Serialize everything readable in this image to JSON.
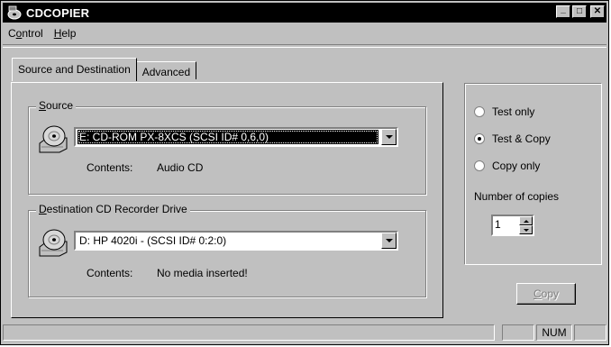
{
  "app": {
    "title": "CDCOPIER"
  },
  "window_controls": {
    "minimize": "_",
    "maximize": "□",
    "close": "✕"
  },
  "menu": [
    {
      "prefix": "C",
      "underlined": "o",
      "rest": "ntrol"
    },
    {
      "prefix": "",
      "underlined": "H",
      "rest": "elp"
    }
  ],
  "tabs": {
    "source_destination": "Source and Destination",
    "advanced": "Advanced"
  },
  "source": {
    "legend_underlined": "S",
    "legend_rest": "ource",
    "drive": "E: CD-ROM PX-8XCS   (SCSI ID# 0,6,0)",
    "contents_label": "Contents:",
    "contents_value": "Audio CD"
  },
  "destination": {
    "legend_underlined": "D",
    "legend_rest": "estination CD Recorder Drive",
    "drive": "D: HP 4020i - (SCSI ID# 0:2:0)",
    "contents_label": "Contents:",
    "contents_value": "No media inserted!"
  },
  "mode": {
    "options": [
      {
        "label": "Test only",
        "checked": false
      },
      {
        "label": "Test & Copy",
        "checked": true
      },
      {
        "label": "Copy only",
        "checked": false
      }
    ],
    "copies_label": "Number of copies",
    "copies_value": "1"
  },
  "copy_button": {
    "underlined": "C",
    "rest": "opy"
  },
  "status": {
    "num": "NUM"
  },
  "icons": [
    "cd-app-icon",
    "cd-drive-icon",
    "spinner-up-icon",
    "spinner-down-icon",
    "dropdown-arrow-icon"
  ]
}
